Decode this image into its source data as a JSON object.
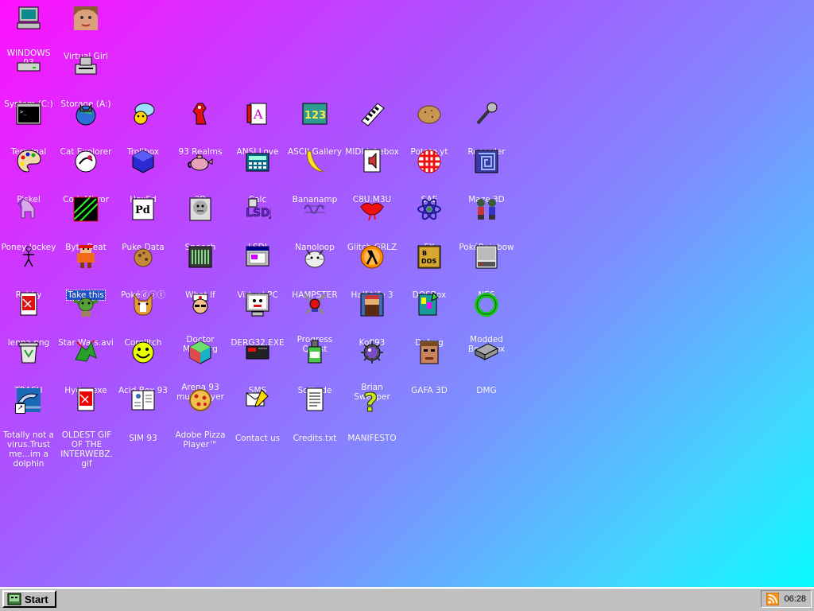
{
  "desktop": {
    "icons": [
      {
        "label": "WINDOWS 93",
        "icon": "computer-icon"
      },
      {
        "label": "Virtual Girl",
        "icon": "girl-face-icon"
      },
      {
        "label": "System (C:)",
        "icon": "hard-drive-icon"
      },
      {
        "label": "Storage (A:)",
        "icon": "floppy-drive-icon"
      },
      {
        "label": "Terminal",
        "icon": "terminal-icon"
      },
      {
        "label": "Cat Explorer",
        "icon": "cat-globe-icon"
      },
      {
        "label": "Trollbox",
        "icon": "chat-bubble-icon"
      },
      {
        "label": "93 Realms",
        "icon": "knight-icon"
      },
      {
        "label": "ANSI Love",
        "icon": "ansi-letter-icon"
      },
      {
        "label": "ASCII Gallery",
        "icon": "ascii-123-icon"
      },
      {
        "label": "MIDI Jukebox",
        "icon": "piano-keys-icon"
      },
      {
        "label": "Potato.yt",
        "icon": "potato-icon"
      },
      {
        "label": "Recorder",
        "icon": "microphone-icon"
      },
      {
        "label": "Piskel",
        "icon": "palette-icon"
      },
      {
        "label": "CodeMirror",
        "icon": "codemirror-icon"
      },
      {
        "label": "HexEd",
        "icon": "cube-icon"
      },
      {
        "label": "3D",
        "icon": "teapot-icon"
      },
      {
        "label": "Calc",
        "icon": "calculator-icon"
      },
      {
        "label": "Bananamp",
        "icon": "banana-icon"
      },
      {
        "label": "C8U.M3U",
        "icon": "playlist-icon"
      },
      {
        "label": "SAE",
        "icon": "amiga-ball-icon"
      },
      {
        "label": "Maze 3D",
        "icon": "maze-icon"
      },
      {
        "label": "Poney Jockey",
        "icon": "pony-icon"
      },
      {
        "label": "Byte Beat",
        "icon": "bytebeat-icon"
      },
      {
        "label": "Puke Data",
        "icon": "pd-icon"
      },
      {
        "label": "Speech",
        "icon": "face-speech-icon"
      },
      {
        "label": "LSDJ",
        "icon": "lsdj-icon"
      },
      {
        "label": "Nanoloop",
        "icon": "wave-icon"
      },
      {
        "label": "Glitch GRLZ",
        "icon": "lips-icon"
      },
      {
        "label": "FX",
        "icon": "atom-icon"
      },
      {
        "label": "PokéRainbow",
        "icon": "trainers-icon"
      },
      {
        "label": "Robby",
        "icon": "stick-figure-icon"
      },
      {
        "label": "Take this",
        "icon": "pixel-character-icon"
      },
      {
        "label": "Pokéⓓⓞⓣ",
        "icon": "pokedot-icon"
      },
      {
        "label": "What If",
        "icon": "whatif-icon"
      },
      {
        "label": "Virtual PC",
        "icon": "window-icon"
      },
      {
        "label": "HAMPSTER",
        "icon": "hamster-icon"
      },
      {
        "label": "Half-Life 3",
        "icon": "half-life-icon"
      },
      {
        "label": "DOSBox",
        "icon": "dosbox-icon"
      },
      {
        "label": "NES",
        "icon": "nes-icon"
      },
      {
        "label": "lenna.png",
        "icon": "image-file-icon"
      },
      {
        "label": "Star Wars.avi",
        "icon": "yoda-icon"
      },
      {
        "label": "Corglitch",
        "icon": "corgi-icon"
      },
      {
        "label": "Doctor Marburg",
        "icon": "doctor-icon"
      },
      {
        "label": "DERG32.EXE",
        "icon": "derg-monitor-icon"
      },
      {
        "label": "Progress Quest",
        "icon": "crossed-swords-icon"
      },
      {
        "label": "Kof'93",
        "icon": "fighter-icon"
      },
      {
        "label": "Defrag",
        "icon": "defrag-icon"
      },
      {
        "label": "Modded BeepBox",
        "icon": "green-ring-icon"
      },
      {
        "label": "TRASH",
        "icon": "recycle-bin-icon"
      },
      {
        "label": "Hydra.exe",
        "icon": "dragon-icon"
      },
      {
        "label": "Acid Box 93",
        "icon": "smiley-icon"
      },
      {
        "label": "Arena 93 multiplayer",
        "icon": "rgb-cube-icon"
      },
      {
        "label": "SMS",
        "icon": "console-icon"
      },
      {
        "label": "Solitude",
        "icon": "bottle-icon"
      },
      {
        "label": "Brian Sweeper",
        "icon": "mine-icon"
      },
      {
        "label": "GAFA 3D",
        "icon": "marine-face-icon"
      },
      {
        "label": "DMG",
        "icon": "dmg-icon"
      },
      {
        "label": "Totally not a virus.Trust me...im a dolphin",
        "icon": "dolphin-icon"
      },
      {
        "label": "OLDEST GIF OF THE INTERWEBZ.gif",
        "icon": "gif-file-icon"
      },
      {
        "label": "SIM 93",
        "icon": "book-icon"
      },
      {
        "label": "Adobe Pizza Player™",
        "icon": "pizza-icon"
      },
      {
        "label": "Contact us",
        "icon": "contact-icon"
      },
      {
        "label": "Credits.txt",
        "icon": "text-file-icon"
      },
      {
        "label": "MANIFESTO",
        "icon": "question-mark-icon"
      }
    ]
  },
  "taskbar": {
    "start_label": "Start",
    "clock": "06:28"
  },
  "colors": {
    "selection": "#1c51c9",
    "taskbar": "#c0c0c0"
  }
}
